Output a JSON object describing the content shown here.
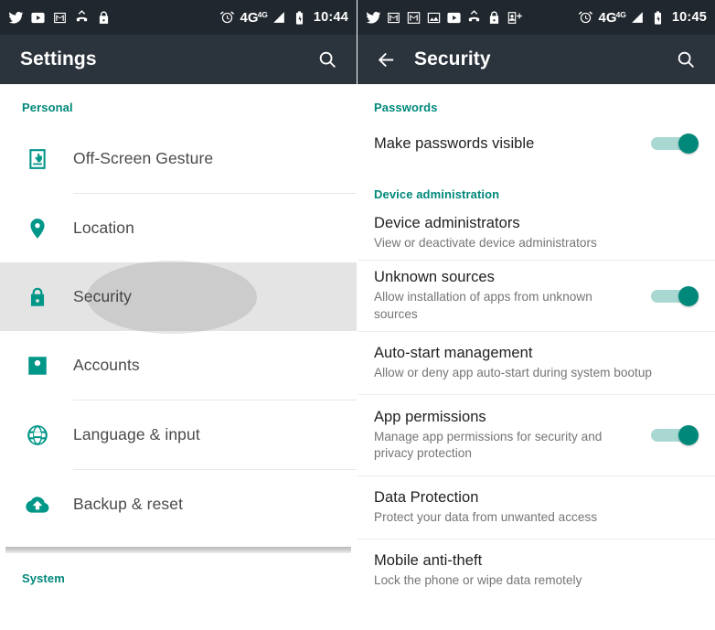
{
  "accent": "#009688",
  "toggle_on_color": "#00897b",
  "toggle_track_color": "#a8d8d1",
  "appbar_color": "#2b333c",
  "statusbar_color": "#21272e",
  "left_screen": {
    "status_bar": {
      "icons": [
        "twitter-icon",
        "youtube-icon",
        "gmail-icon",
        "missed-call-icon",
        "lock-icon"
      ],
      "alarm_icon": "alarm-icon",
      "network_label": "4G",
      "network_superscript": "4G",
      "signal_icon": "signal-bars-icon",
      "battery_icon": "battery-charging-icon",
      "time": "10:44"
    },
    "appbar": {
      "title": "Settings",
      "search_icon": "search-icon"
    },
    "sections": [
      {
        "header": "Personal"
      },
      {
        "header": "System"
      }
    ],
    "items": [
      {
        "label": "Off-Screen Gesture",
        "icon": "off-screen-gesture-icon",
        "selected": false
      },
      {
        "label": "Location",
        "icon": "location-pin-icon",
        "selected": false
      },
      {
        "label": "Security",
        "icon": "lock-icon",
        "selected": true
      },
      {
        "label": "Accounts",
        "icon": "person-account-icon",
        "selected": false
      },
      {
        "label": "Language & input",
        "icon": "globe-icon",
        "selected": false
      },
      {
        "label": "Backup & reset",
        "icon": "cloud-upload-icon",
        "selected": false
      }
    ]
  },
  "right_screen": {
    "status_bar": {
      "icons": [
        "twitter-icon",
        "gmail-icon",
        "gmail-boxed-icon",
        "photo-icon",
        "youtube-icon",
        "missed-call-icon",
        "lock-icon",
        "add-contact-icon"
      ],
      "alarm_icon": "alarm-icon",
      "network_label": "4G",
      "network_superscript": "4G",
      "signal_icon": "signal-bars-icon",
      "battery_icon": "battery-charging-icon",
      "time": "10:45"
    },
    "appbar": {
      "back_icon": "back-arrow-icon",
      "title": "Security",
      "search_icon": "search-icon"
    },
    "sections": [
      {
        "header": "Passwords"
      },
      {
        "header": "Device administration"
      }
    ],
    "items": [
      {
        "title": "Make passwords visible",
        "subtitle": "",
        "has_toggle": true,
        "toggle_state": "on"
      },
      {
        "title": "Device administrators",
        "subtitle": "View or deactivate device administrators",
        "has_toggle": false,
        "toggle_state": ""
      },
      {
        "title": "Unknown sources",
        "subtitle": "Allow installation of apps from unknown sources",
        "has_toggle": true,
        "toggle_state": "on"
      },
      {
        "title": "Auto-start management",
        "subtitle": "Allow or deny app auto-start during system bootup",
        "has_toggle": false,
        "toggle_state": ""
      },
      {
        "title": "App permissions",
        "subtitle": "Manage app permissions for security and privacy protection",
        "has_toggle": true,
        "toggle_state": "on"
      },
      {
        "title": "Data Protection",
        "subtitle": "Protect your data from unwanted access",
        "has_toggle": false,
        "toggle_state": ""
      },
      {
        "title": "Mobile anti-theft",
        "subtitle": "Lock the phone or wipe data remotely",
        "has_toggle": false,
        "toggle_state": ""
      }
    ]
  }
}
